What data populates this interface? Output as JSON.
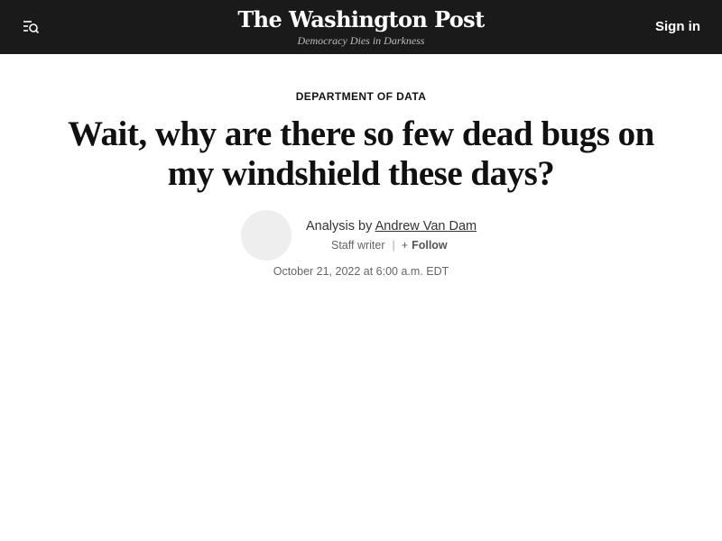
{
  "header": {
    "masthead_title": "The Washington Post",
    "tagline": "Democracy Dies in Darkness",
    "signin_label": "Sign in",
    "menu_icon": "menu-search-icon"
  },
  "article": {
    "kicker": "DEPARTMENT OF DATA",
    "headline": "Wait, why are there so few dead bugs on my windshield these days?",
    "byline_prefix": "Analysis by",
    "author_name": "Andrew Van Dam",
    "author_role": "Staff writer",
    "separator": "|",
    "follow_plus": "+",
    "follow_label": "Follow",
    "dateline": "October 21, 2022 at 6:00 a.m. EDT"
  },
  "colors": {
    "topbar_bg": "#1a1a1a",
    "avatar_placeholder": "#eeeeee"
  }
}
